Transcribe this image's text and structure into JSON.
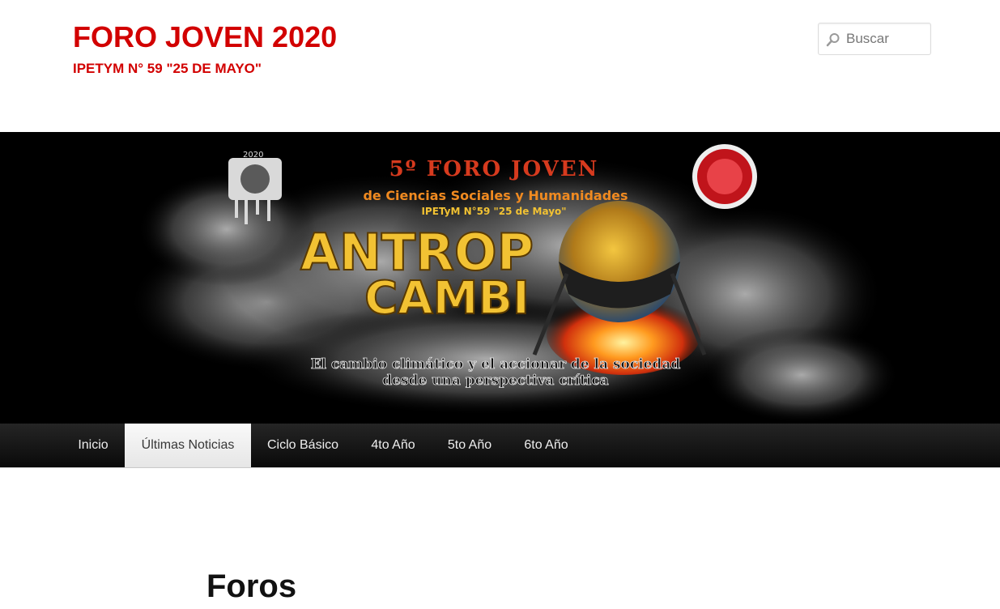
{
  "header": {
    "site_title": "FORO JOVEN 2020",
    "site_description": "IPETYM N° 59 \"25 DE MAYO\"",
    "search_placeholder": "Buscar"
  },
  "banner": {
    "headline": "5º FORO JOVEN",
    "subtitle": "de Ciencias Sociales y Humanidades",
    "school": "IPETyM N°59 \"25 de Mayo\"",
    "title_line1": "ANTROP",
    "title_line2": "CAMBI",
    "tagline_line1": "El cambio climático y el accionar de la sociedad",
    "tagline_line2": "desde una perspectiva crítica",
    "logo_caption": "2020"
  },
  "nav": {
    "items": [
      {
        "label": "Inicio"
      },
      {
        "label": "Últimas Noticias"
      },
      {
        "label": "Ciclo Básico"
      },
      {
        "label": "4to Año"
      },
      {
        "label": "5to Año"
      },
      {
        "label": "6to Año"
      }
    ],
    "active": "Últimas Noticias"
  },
  "main": {
    "page_title": "Foros"
  },
  "colors": {
    "brand_red": "#d20000",
    "nav_dark": "#1a1a1a",
    "banner_gold": "#f2c233",
    "banner_red": "#d63a1e"
  }
}
